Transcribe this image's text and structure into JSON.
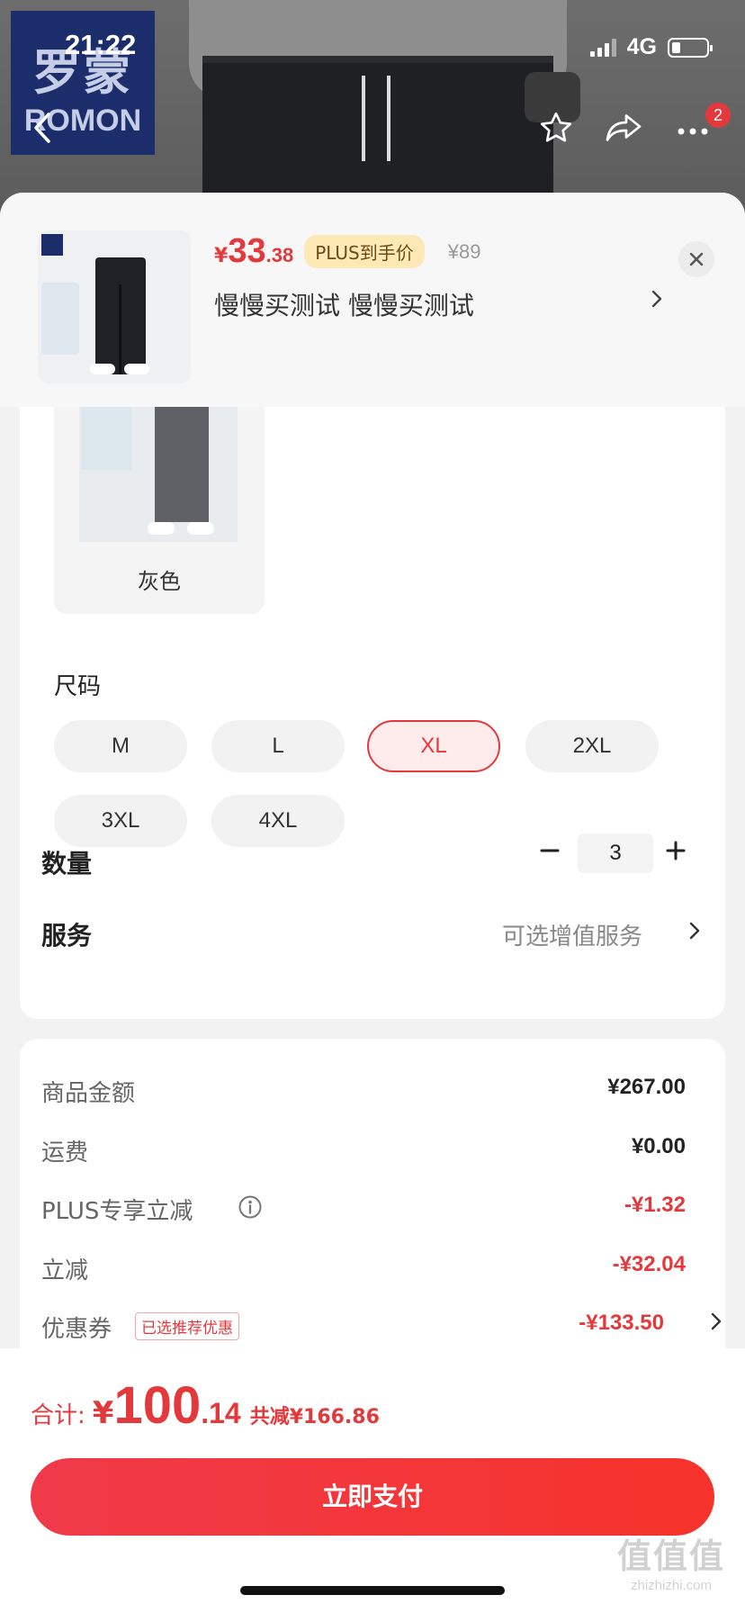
{
  "status_bar": {
    "time": "21:22",
    "network": "4G"
  },
  "brand_logo": {
    "cn": "罗蒙",
    "en": "ROMON"
  },
  "nav": {
    "cart_badge": "2"
  },
  "product": {
    "price_currency": "¥",
    "price_int": "33",
    "price_dec": ".38",
    "plus_tag": "PLUS到手价",
    "original_price": "¥89",
    "selected_spec": "慢慢买测试  慢慢买测试"
  },
  "color_option": {
    "label": "灰色"
  },
  "size": {
    "title": "尺码",
    "options": [
      "M",
      "L",
      "XL",
      "2XL",
      "3XL",
      "4XL"
    ],
    "selected": "XL"
  },
  "quantity": {
    "title": "数量",
    "value": "3"
  },
  "service": {
    "title": "服务",
    "value": "可选增值服务"
  },
  "price_details": [
    {
      "label": "商品金额",
      "value": "¥267.00",
      "red": false
    },
    {
      "label": "运费",
      "value": "¥0.00",
      "red": false
    },
    {
      "label": "PLUS专享立减",
      "value": "-¥1.32",
      "red": true
    },
    {
      "label": "立减",
      "value": "-¥32.04",
      "red": true
    },
    {
      "label": "优惠券",
      "value": "-¥133.50",
      "red": true,
      "tag": "已选推荐优惠"
    }
  ],
  "footer": {
    "total_label": "合计:",
    "total_currency": "¥",
    "total_int": "100",
    "total_dec": ".14",
    "total_save": "共减¥166.86",
    "pay_button": "立即支付"
  },
  "watermark": {
    "main": "值值值",
    "sub": "zhizhizhi.com"
  },
  "colors": {
    "accent_red": "#e4393c",
    "plus_gold": "#fde9b6"
  }
}
